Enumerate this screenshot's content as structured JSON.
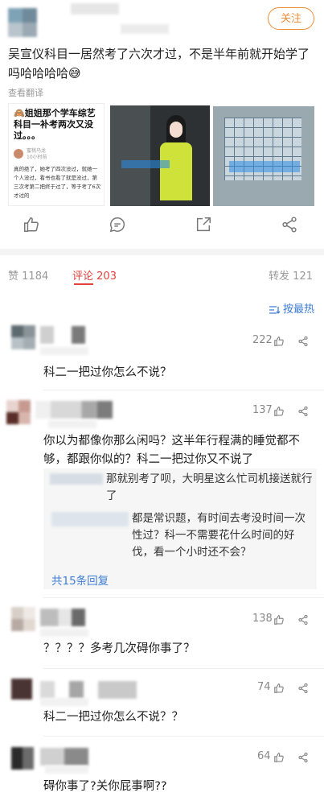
{
  "post": {
    "follow_label": "关注",
    "text": "吴宣仪科目一居然考了六次才过，不是半年前就开始学了吗哈哈哈哈😅",
    "translate_label": "查看翻译",
    "image1": {
      "title": "🙈姐姐那个学车综艺科目一补考两次又没过。。。",
      "author_line1": "蜜桃乌龙",
      "author_line2": "10小时前",
      "body": "真的绝了，她考了四次没过，就她一个人没过，看书也看了就是没过，第三次考第二把终于过了，等于考了6次才过的"
    }
  },
  "stats": {
    "like_label": "赞",
    "like_count": "1184",
    "comment_label": "评论",
    "comment_count": "203",
    "repost_label": "转发",
    "repost_count": "121"
  },
  "sort_label": "按最热",
  "comments": [
    {
      "likes": "222",
      "text": "科二一把过你怎么不说？"
    },
    {
      "likes": "137",
      "text": "你以为都像你那么闲吗？这半年行程满的睡觉都不够，都跟你似的？科二一把过你又不说了",
      "replies": [
        "那就别考了呗，大明星这么忙司机接送就行了",
        "都是常识题，有时间去考没时间一次性过？科一不需要花什么时间的好伐，看一个小时还不会？"
      ],
      "more_label": "共15条回复"
    },
    {
      "likes": "138",
      "text": "？？？？多考几次碍你事了？"
    },
    {
      "likes": "74",
      "text": "科二一把过你怎么不说？？"
    },
    {
      "likes": "64",
      "text": "碍你事了?关你屁事啊??"
    }
  ],
  "colors": {
    "accent_orange": "#f08d3a",
    "comment_red": "#e3433b",
    "link_blue": "#3d7dd6"
  }
}
